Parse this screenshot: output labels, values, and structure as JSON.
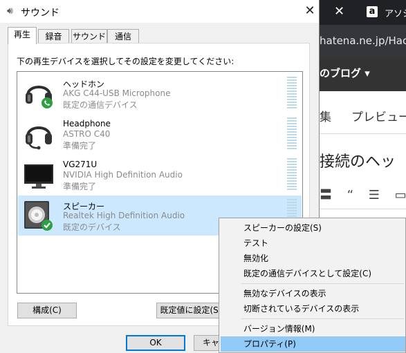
{
  "browser": {
    "close_glyph": "✕",
    "amazon_icon": "a",
    "tab_title": "アソシエ",
    "url": "hatena.ne.jp/Hac",
    "blog_menu": "のブログ ▾",
    "tab_edit": "集",
    "tab_preview": "プレビュー",
    "heading": "接続のヘッ",
    "toolbar": "〓 “ ☰ ▭"
  },
  "dialog": {
    "title": "サウンド",
    "close_glyph": "✕",
    "tabs": [
      {
        "label": "再生"
      },
      {
        "label": "録音"
      },
      {
        "label": "サウンド"
      },
      {
        "label": "通信"
      }
    ],
    "instruction": "下の再生デバイスを選択してその設定を変更してください:",
    "devices": [
      {
        "name": "ヘッドホン",
        "sub": "AKG C44-USB Microphone",
        "status": "既定の通信デバイス",
        "icon": "headphones-phone-icon"
      },
      {
        "name": "Headphone",
        "sub": "ASTRO C40",
        "status": "準備完了",
        "icon": "headset-icon"
      },
      {
        "name": "VG271U",
        "sub": "NVIDIA High Definition Audio",
        "status": "準備完了",
        "icon": "monitor-icon"
      },
      {
        "name": "スピーカー",
        "sub": "Realtek High Definition Audio",
        "status": "既定のデバイス",
        "icon": "speaker-check-icon"
      }
    ],
    "configure_button": "構成(C)",
    "set_default_button": "既定値に設定(S)",
    "ok_button": "OK",
    "cancel_button": "キャンセル"
  },
  "context_menu": {
    "items": [
      {
        "label": "スピーカーの設定(S)"
      },
      {
        "label": "テスト"
      },
      {
        "label": "無効化"
      },
      {
        "label": "既定の通信デバイスとして設定(C)"
      },
      {
        "label": "無効なデバイスの表示"
      },
      {
        "label": "切断されているデバイスの表示"
      },
      {
        "label": "バージョン情報(M)"
      },
      {
        "label": "プロパティ(P)"
      }
    ]
  },
  "colors": {
    "selection": "#cce8ff",
    "menu_highlight": "#91c9f7",
    "default_button_border": "#0078d7",
    "check_badge": "#2ea043"
  }
}
